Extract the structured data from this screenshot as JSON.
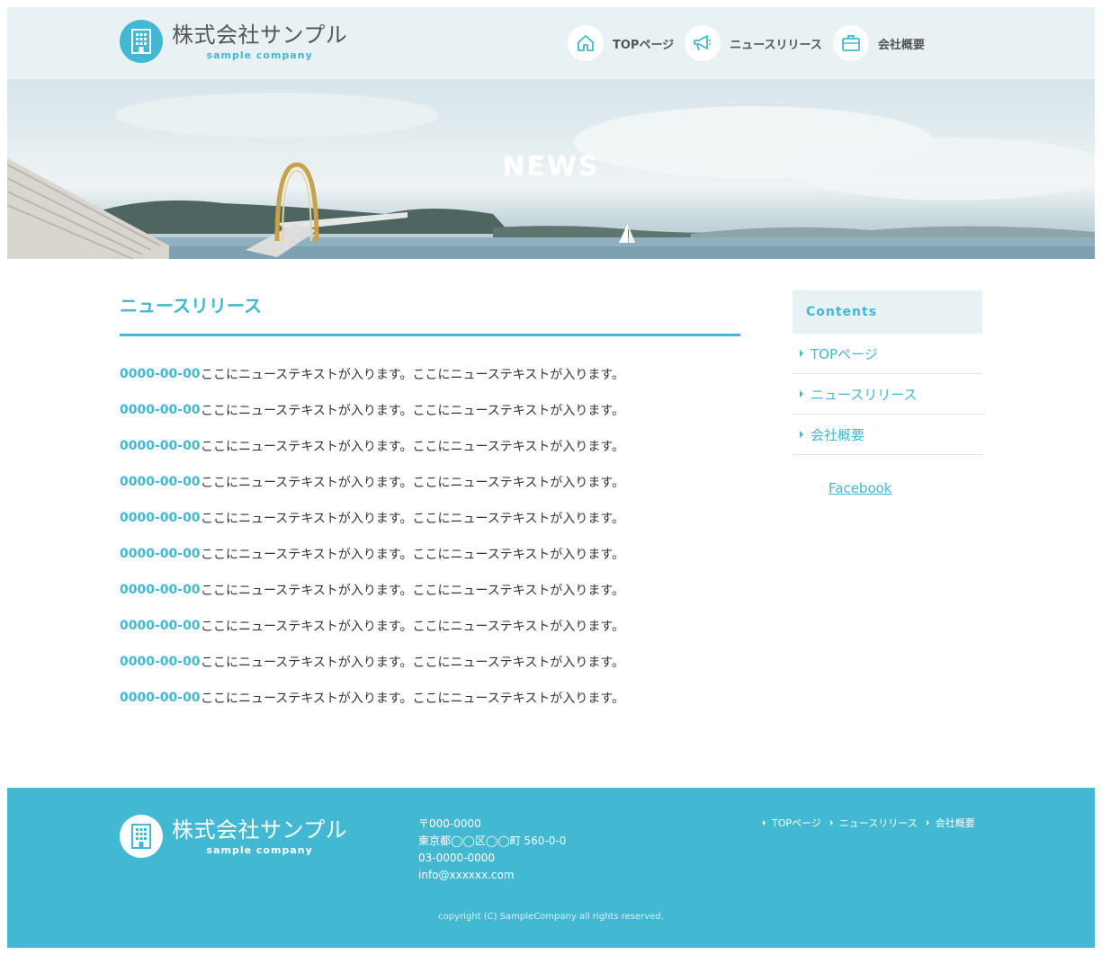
{
  "header": {
    "logo": {
      "name": "株式会社サンプル",
      "sub": "sample company"
    },
    "nav": [
      {
        "label": "TOPページ",
        "icon": "home-icon"
      },
      {
        "label": "ニュースリリース",
        "icon": "megaphone-icon"
      },
      {
        "label": "会社概要",
        "icon": "briefcase-icon"
      }
    ]
  },
  "hero": {
    "title": "NEWS"
  },
  "main": {
    "title": "ニュースリリース",
    "news": [
      {
        "date": "0000-00-00",
        "text": "ここにニューステキストが入ります。ここにニューステキストが入ります。"
      },
      {
        "date": "0000-00-00",
        "text": "ここにニューステキストが入ります。ここにニューステキストが入ります。"
      },
      {
        "date": "0000-00-00",
        "text": "ここにニューステキストが入ります。ここにニューステキストが入ります。"
      },
      {
        "date": "0000-00-00",
        "text": "ここにニューステキストが入ります。ここにニューステキストが入ります。"
      },
      {
        "date": "0000-00-00",
        "text": "ここにニューステキストが入ります。ここにニューステキストが入ります。"
      },
      {
        "date": "0000-00-00",
        "text": "ここにニューステキストが入ります。ここにニューステキストが入ります。"
      },
      {
        "date": "0000-00-00",
        "text": "ここにニューステキストが入ります。ここにニューステキストが入ります。"
      },
      {
        "date": "0000-00-00",
        "text": "ここにニューステキストが入ります。ここにニューステキストが入ります。"
      },
      {
        "date": "0000-00-00",
        "text": "ここにニューステキストが入ります。ここにニューステキストが入ります。"
      },
      {
        "date": "0000-00-00",
        "text": "ここにニューステキストが入ります。ここにニューステキストが入ります。"
      }
    ]
  },
  "sidebar": {
    "heading": "Contents",
    "items": [
      {
        "label": "TOPページ"
      },
      {
        "label": "ニュースリリース"
      },
      {
        "label": "会社概要"
      }
    ],
    "facebook": "Facebook"
  },
  "footer": {
    "logo": {
      "name": "株式会社サンプル",
      "sub": "sample company"
    },
    "address": {
      "postal": "〒000-0000",
      "street": "東京都◯◯区◯◯町 560-0-0",
      "phone": "03-0000-0000",
      "email": "info@xxxxxx.com"
    },
    "nav": [
      {
        "label": "TOPページ"
      },
      {
        "label": "ニュースリリース"
      },
      {
        "label": "会社概要"
      }
    ],
    "copyright": "copyright (C) SampleCompany all rights reserved."
  },
  "colors": {
    "accent": "#42b8d3",
    "header_bg": "#e8f1f3",
    "text": "#333333"
  }
}
